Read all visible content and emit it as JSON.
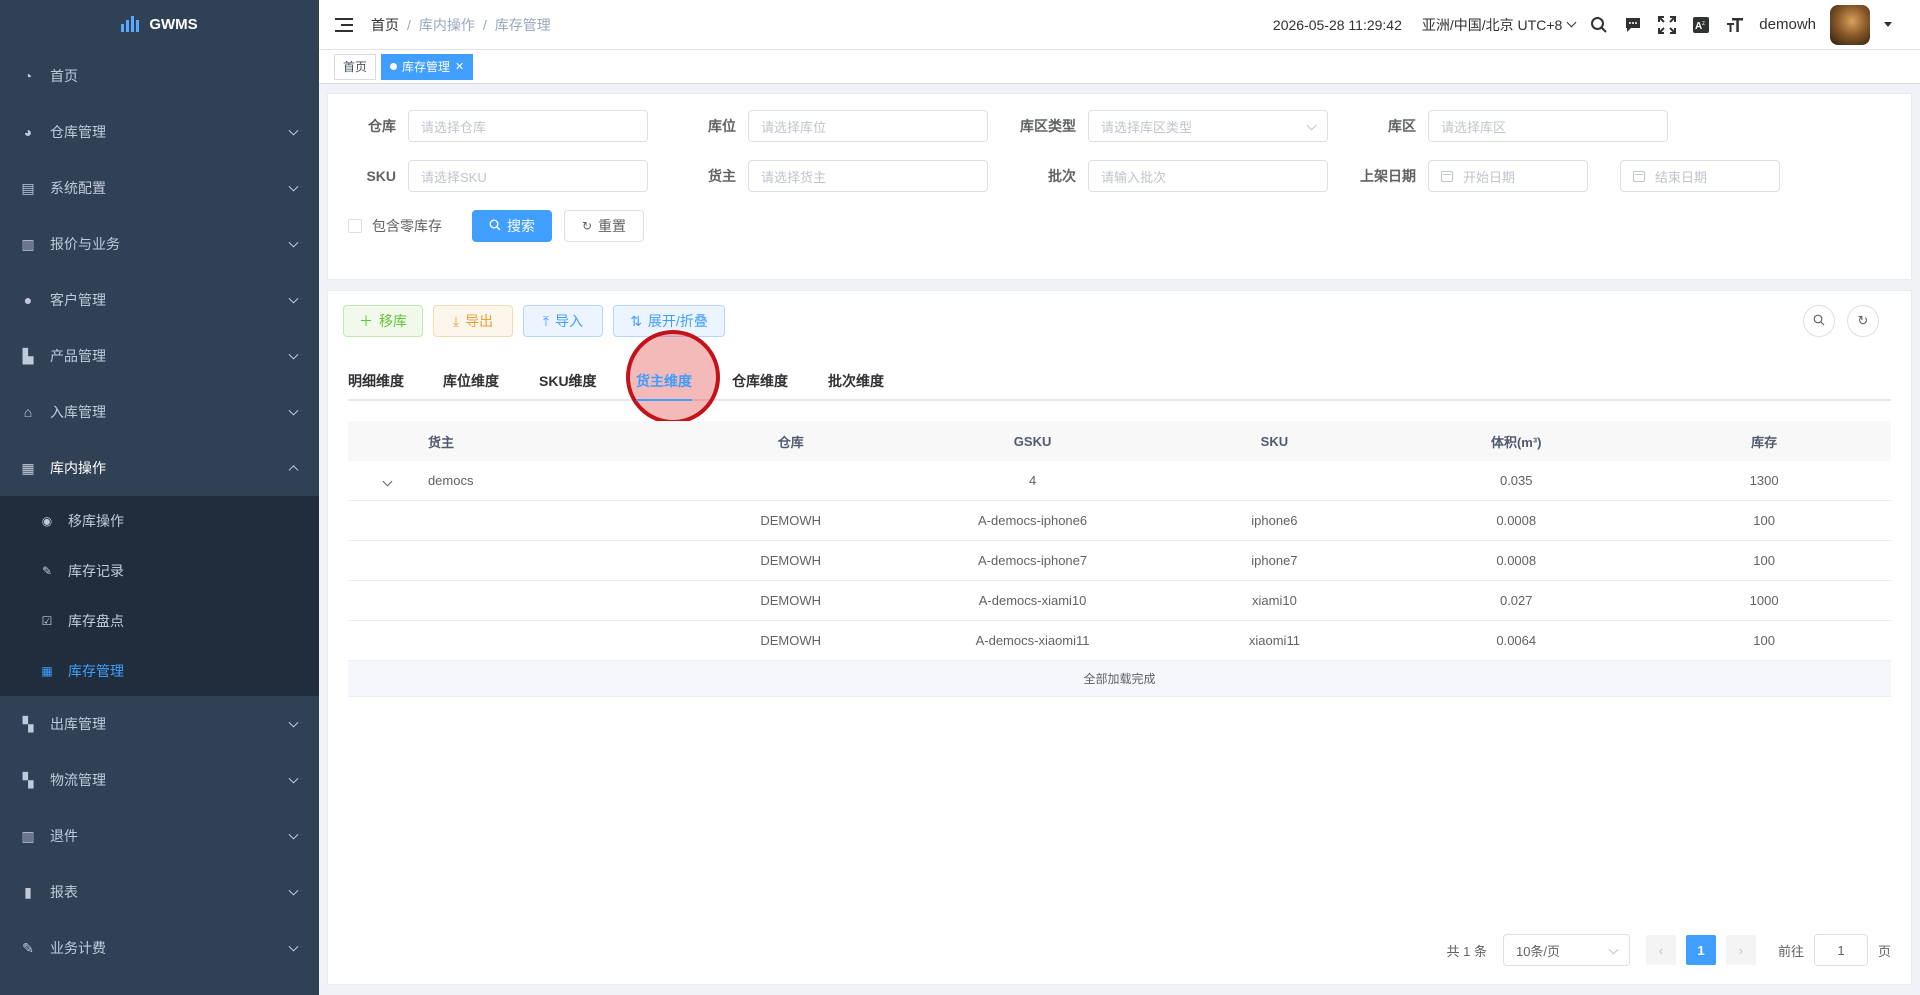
{
  "sidebar": {
    "logo_text": "GWMS",
    "items": [
      {
        "label": "首页"
      },
      {
        "label": "仓库管理"
      },
      {
        "label": "系统配置"
      },
      {
        "label": "报价与业务"
      },
      {
        "label": "客户管理"
      },
      {
        "label": "产品管理"
      },
      {
        "label": "入库管理"
      },
      {
        "label": "库内操作"
      },
      {
        "label": "出库管理"
      },
      {
        "label": "物流管理"
      },
      {
        "label": "退件"
      },
      {
        "label": "报表"
      },
      {
        "label": "业务计费"
      }
    ],
    "subitems": [
      {
        "label": "移库操作"
      },
      {
        "label": "库存记录"
      },
      {
        "label": "库存盘点"
      },
      {
        "label": "库存管理"
      }
    ]
  },
  "header": {
    "breadcrumb": [
      "首页",
      "库内操作",
      "库存管理"
    ],
    "datetime": "2026-05-28 11:29:42",
    "timezone": "亚洲/中国/北京 UTC+8",
    "username": "demowh"
  },
  "tags": {
    "home": "首页",
    "current": "库存管理"
  },
  "search": {
    "warehouse_label": "仓库",
    "warehouse_placeholder": "请选择仓库",
    "location_label": "库位",
    "location_placeholder": "请选择库位",
    "zone_type_label": "库区类型",
    "zone_type_placeholder": "请选择库区类型",
    "zone_label": "库区",
    "zone_placeholder": "请选择库区",
    "sku_label": "SKU",
    "sku_placeholder": "请选择SKU",
    "owner_label": "货主",
    "owner_placeholder": "请选择货主",
    "batch_label": "批次",
    "batch_placeholder": "请输入批次",
    "shelf_date_label": "上架日期",
    "start_date_placeholder": "开始日期",
    "end_date_placeholder": "结束日期",
    "zero_stock_label": "包含零库存",
    "search_button": "搜索",
    "reset_button": "重置"
  },
  "toolbar": {
    "move_button": "移库",
    "export_button": "导出",
    "import_button": "导入",
    "expand_button": "展开/折叠"
  },
  "tabs": [
    "明细维度",
    "库位维度",
    "SKU维度",
    "货主维度",
    "仓库维度",
    "批次维度"
  ],
  "table": {
    "columns": [
      "货主",
      "仓库",
      "GSKU",
      "SKU",
      "体积(m³)",
      "库存"
    ],
    "group": {
      "owner": "democs",
      "gsku": "4",
      "volume": "0.035",
      "stock": "1300"
    },
    "rows": [
      {
        "warehouse": "DEMOWH",
        "gsku": "A-democs-iphone6",
        "sku": "iphone6",
        "volume": "0.0008",
        "stock": "100"
      },
      {
        "warehouse": "DEMOWH",
        "gsku": "A-democs-iphone7",
        "sku": "iphone7",
        "volume": "0.0008",
        "stock": "100"
      },
      {
        "warehouse": "DEMOWH",
        "gsku": "A-democs-xiami10",
        "sku": "xiami10",
        "volume": "0.027",
        "stock": "1000"
      },
      {
        "warehouse": "DEMOWH",
        "gsku": "A-democs-xiaomi11",
        "sku": "xiaomi11",
        "volume": "0.0064",
        "stock": "100"
      }
    ],
    "loaded_text": "全部加载完成"
  },
  "pagination": {
    "total": "共 1 条",
    "page_size": "10条/页",
    "current_page": "1",
    "goto_label": "前往",
    "goto_value": "1",
    "page_unit": "页"
  },
  "colors": {
    "sidebar_bg": "#304156",
    "sidebar_sub_bg": "#1f2d3d",
    "primary": "#409eff",
    "highlight": "#c4121b"
  }
}
